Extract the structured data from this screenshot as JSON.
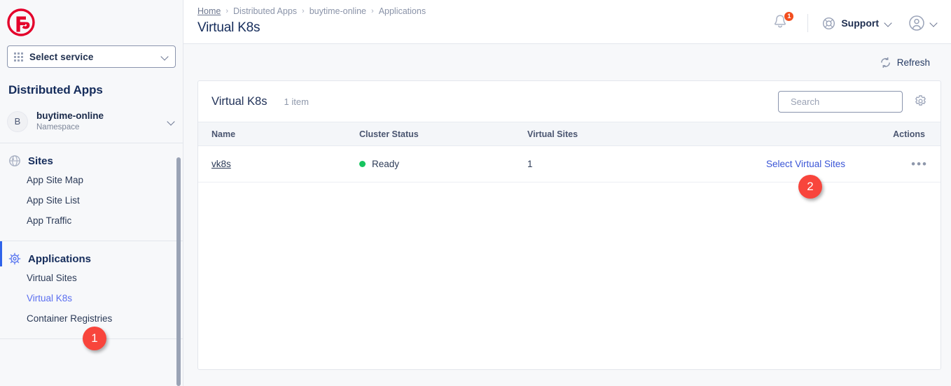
{
  "brand": {
    "logo_icon": "f5-logo",
    "accent": "#e4002b"
  },
  "sidebar": {
    "service_select": {
      "label": "Select service",
      "icon": "grid-dots-icon",
      "chevron": "chevron-down-icon"
    },
    "section_title": "Distributed Apps",
    "namespace": {
      "initial": "B",
      "name": "buytime-online",
      "subtitle": "Namespace",
      "chevron": "chevron-down-icon"
    },
    "groups": [
      {
        "label": "Sites",
        "icon": "globe-icon",
        "active": false,
        "items": [
          {
            "label": "App Site Map",
            "selected": false
          },
          {
            "label": "App Site List",
            "selected": false
          },
          {
            "label": "App Traffic",
            "selected": false
          }
        ]
      },
      {
        "label": "Applications",
        "icon": "kubernetes-helm-icon",
        "active": true,
        "items": [
          {
            "label": "Virtual Sites",
            "selected": false
          },
          {
            "label": "Virtual K8s",
            "selected": true
          },
          {
            "label": "Container Registries",
            "selected": false
          }
        ]
      }
    ],
    "scrollbar": {
      "name": "sidebar-scrollbar"
    }
  },
  "header": {
    "breadcrumbs": [
      {
        "label": "Home",
        "link": true
      },
      {
        "label": "Distributed Apps",
        "link": false
      },
      {
        "label": "buytime-online",
        "link": false
      },
      {
        "label": "Applications",
        "link": false
      }
    ],
    "separator": "›",
    "title": "Virtual K8s",
    "notifications": {
      "icon": "bell-icon",
      "count": "1",
      "badge_color": "#f24e1e"
    },
    "support": {
      "label": "Support",
      "icon": "lifebuoy-icon",
      "chevron": "chevron-down-icon"
    },
    "account": {
      "icon": "user-circle-icon",
      "chevron": "chevron-down-icon"
    }
  },
  "toolbar": {
    "refresh": {
      "label": "Refresh",
      "icon": "refresh-icon"
    }
  },
  "card": {
    "title": "Virtual K8s",
    "count": "1 item",
    "search": {
      "placeholder": "Search",
      "value": "",
      "icon": "search-icon"
    },
    "settings": {
      "icon": "gear-icon"
    },
    "table": {
      "columns": [
        "Name",
        "Cluster Status",
        "Virtual Sites",
        "",
        "Actions"
      ],
      "rows": [
        {
          "name": "vk8s",
          "cluster_status": "Ready",
          "status_color": "#16c45f",
          "virtual_sites": "1",
          "action_link": "Select Virtual Sites",
          "kebab": "•••"
        }
      ]
    }
  },
  "callouts": [
    {
      "id": "1",
      "number": "1",
      "target": "sidebar-item-virtual-k8s"
    },
    {
      "id": "2",
      "number": "2",
      "target": "select-virtual-sites-link"
    }
  ]
}
